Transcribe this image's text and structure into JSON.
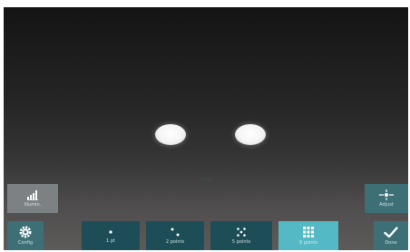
{
  "left_panel": {
    "top_button": {
      "label": "Illumin.",
      "icon": "brightness-bars-icon"
    },
    "bottom_button": {
      "label": "Config",
      "icon": "gear-icon"
    }
  },
  "right_panel": {
    "top_button": {
      "label": "Adjust",
      "icon": "crosshair-icon"
    },
    "bottom_button": {
      "label": "Done",
      "icon": "checkmark-icon"
    }
  },
  "pattern_tabs": [
    {
      "label": "1 pt",
      "icon": "single-dot-icon",
      "active": false
    },
    {
      "label": "2 points",
      "icon": "two-dots-icon",
      "active": false
    },
    {
      "label": "5 points",
      "icon": "five-dots-icon",
      "active": false
    },
    {
      "label": "9 points",
      "icon": "nine-dots-icon",
      "active": true
    }
  ],
  "preview": {
    "faint_label": "0000"
  },
  "colors": {
    "screen_top": "#141414",
    "screen_bottom": "#5d5a5a",
    "teal": "#1b5f6a",
    "teal_active": "#54b9c4",
    "gray_button": "#7c8283"
  }
}
